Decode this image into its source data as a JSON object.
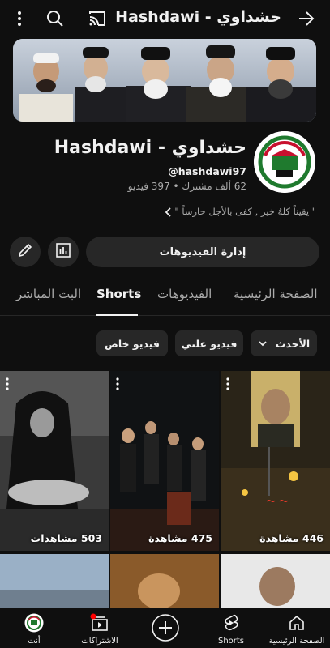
{
  "header": {
    "title": "حشداوي - Hashdawi",
    "back_icon": "arrow-forward-icon",
    "cast_icon": "cast-icon",
    "search_icon": "search-icon",
    "more_icon": "more-vertical-icon"
  },
  "channel": {
    "name": "حشداوي - Hashdawi",
    "handle": "@hashdawi97",
    "stats": "62 ألف مشترك • 397 فيديو",
    "description": "\" يقيناً كلهُ خير , كفى بالأجل حارساً \""
  },
  "actions": {
    "manage_videos": "إدارة الفيديوهات"
  },
  "tabs": [
    {
      "label": "الصفحة الرئيسية",
      "active": false
    },
    {
      "label": "الفيديوهات",
      "active": false
    },
    {
      "label": "Shorts",
      "active": true
    },
    {
      "label": "البث المباشر",
      "active": false
    }
  ],
  "filters": {
    "sort_label": "الأحدث",
    "chips": [
      "فيديو علني",
      "فيديو خاص"
    ]
  },
  "shorts": [
    {
      "views": "446 مشاهدة"
    },
    {
      "views": "475 مشاهدة"
    },
    {
      "views": "503 مشاهدات"
    }
  ],
  "bottom_nav": [
    {
      "label": "الصفحة الرئيسية",
      "icon": "home-icon"
    },
    {
      "label": "Shorts",
      "icon": "shorts-icon"
    },
    {
      "label": "",
      "icon": "create-plus-icon"
    },
    {
      "label": "الاشتراكات",
      "icon": "subscriptions-icon"
    },
    {
      "label": "أنت",
      "icon": "profile-avatar-icon"
    }
  ],
  "colors": {
    "background": "#0f0f0f",
    "surface": "#272727",
    "text": "#f1f1f1",
    "secondary_text": "#aaaaaa",
    "notification_dot": "#ff0000"
  }
}
